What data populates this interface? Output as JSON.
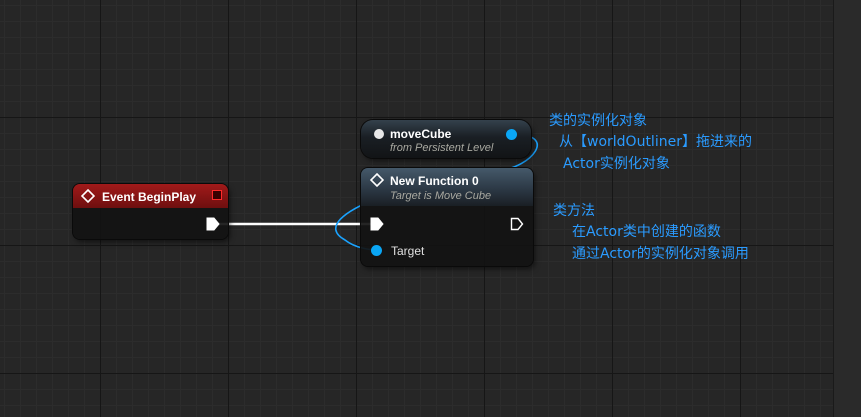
{
  "nodes": {
    "event_begin_play": {
      "title": "Event BeginPlay"
    },
    "move_cube": {
      "title": "moveCube",
      "subtitle": "from Persistent Level"
    },
    "new_function": {
      "title": "New Function 0",
      "subtitle": "Target is Move Cube",
      "target_pin_label": "Target"
    }
  },
  "annotations": {
    "actor_instance": {
      "line1": "类的实例化对象",
      "line2": "从【worldOutliner】拖进来的",
      "line3": "Actor实例化对象"
    },
    "class_method": {
      "line1": "类方法",
      "line2": "在Actor类中创建的函数",
      "line3": "通过Actor的实例化对象调用"
    }
  },
  "colors": {
    "event_header": "#8a1414",
    "function_header": "#3c4e5e",
    "object_pin": "#00a8f4",
    "annotation_text": "#2a9bff",
    "exec_wire": "#ffffff"
  }
}
